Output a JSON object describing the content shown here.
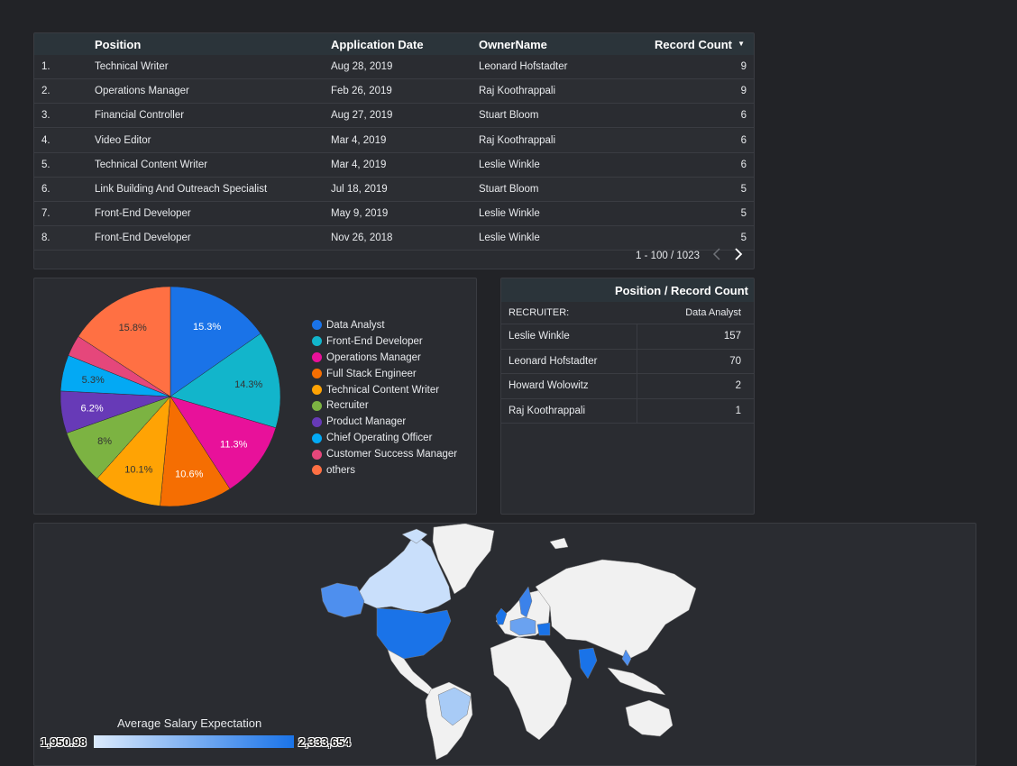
{
  "table": {
    "headers": {
      "position": "Position",
      "application_date": "Application Date",
      "owner": "OwnerName",
      "record_count": "Record Count",
      "sort_icon": "caret-down-icon"
    },
    "rows": [
      {
        "idx": "1.",
        "position": "Technical Writer",
        "date": "Aug 28, 2019",
        "owner": "Leonard Hofstadter",
        "count": "9"
      },
      {
        "idx": "2.",
        "position": "Operations Manager",
        "date": "Feb 26, 2019",
        "owner": "Raj Koothrappali",
        "count": "9"
      },
      {
        "idx": "3.",
        "position": "Financial Controller",
        "date": "Aug 27, 2019",
        "owner": "Stuart Bloom",
        "count": "6"
      },
      {
        "idx": "4.",
        "position": "Video Editor",
        "date": "Mar 4, 2019",
        "owner": "Raj Koothrappali",
        "count": "6"
      },
      {
        "idx": "5.",
        "position": "Technical Content Writer",
        "date": "Mar 4, 2019",
        "owner": "Leslie Winkle",
        "count": "6"
      },
      {
        "idx": "6.",
        "position": "Link Building And Outreach Specialist",
        "date": "Jul 18, 2019",
        "owner": "Stuart Bloom",
        "count": "5"
      },
      {
        "idx": "7.",
        "position": "Front-End Developer",
        "date": "May 9, 2019",
        "owner": "Leslie Winkle",
        "count": "5"
      },
      {
        "idx": "8.",
        "position": "Front-End Developer",
        "date": "Nov 26, 2018",
        "owner": "Leslie Winkle",
        "count": "5"
      }
    ],
    "pager": {
      "range": "1 - 100 / 1023",
      "prev_icon": "chevron-left-icon",
      "next_icon": "chevron-right-icon"
    }
  },
  "chart_data": {
    "type": "pie",
    "slices": [
      {
        "label": "Data Analyst",
        "value": 15.3,
        "display": "15.3%",
        "color": "#1a73e8"
      },
      {
        "label": "Front-End Developer",
        "value": 14.3,
        "display": "14.3%",
        "color": "#12b5cb"
      },
      {
        "label": "Operations Manager",
        "value": 11.3,
        "display": "11.3%",
        "color": "#e8119a"
      },
      {
        "label": "Full Stack Engineer",
        "value": 10.6,
        "display": "10.6%",
        "color": "#f56e02"
      },
      {
        "label": "Technical Content Writer",
        "value": 10.1,
        "display": "10.1%",
        "color": "#ffa304"
      },
      {
        "label": "Recruiter",
        "value": 8.0,
        "display": "8%",
        "color": "#7cb342"
      },
      {
        "label": "Product Manager",
        "value": 6.2,
        "display": "6.2%",
        "color": "#673ab7"
      },
      {
        "label": "Chief Operating Officer",
        "value": 5.3,
        "display": "5.3%",
        "color": "#03a9f4"
      },
      {
        "label": "Customer Success Manager",
        "value": 3.1,
        "display": "",
        "color": "#e5477b"
      },
      {
        "label": "others",
        "value": 15.8,
        "display": "15.8%",
        "color": "#ff7043"
      }
    ],
    "legend_position": "right"
  },
  "pivot": {
    "title": "Position / Record Count",
    "row_header": "RECRUITER:",
    "col_header": "Data Analyst",
    "rows": [
      {
        "name": "Leslie Winkle",
        "value": "157"
      },
      {
        "name": "Leonard Hofstadter",
        "value": "70"
      },
      {
        "name": "Howard Wolowitz",
        "value": "2"
      },
      {
        "name": "Raj Koothrappali",
        "value": "1"
      }
    ]
  },
  "map": {
    "legend_title": "Average Salary Expectation",
    "min_label": "1,950.98",
    "max_label": "2,333,654",
    "colors": {
      "low": "#dbeafc",
      "high": "#1a73e8",
      "no_data": "#f1f1f1"
    }
  }
}
